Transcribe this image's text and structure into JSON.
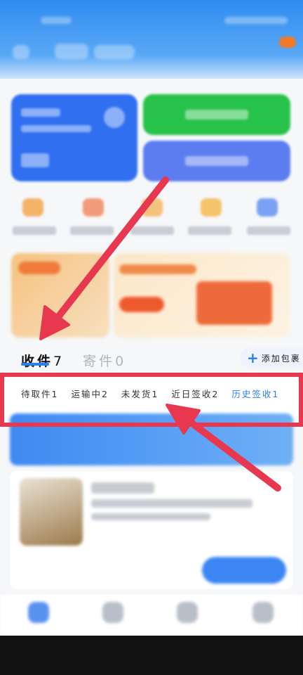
{
  "tabs": {
    "receive": {
      "label": "收件",
      "count": "7"
    },
    "send": {
      "label": "寄件",
      "count": "0"
    }
  },
  "add_parcel_button": {
    "icon": "plus-icon",
    "label": "添加包裹"
  },
  "status_filters": [
    {
      "label": "待取件1"
    },
    {
      "label": "运输中2"
    },
    {
      "label": "未发货1"
    },
    {
      "label": "近日签收2"
    },
    {
      "label": "历史签收1",
      "selected": true
    }
  ],
  "colors": {
    "accent": "#2a7ef0",
    "annotation": "#e8384f",
    "header_blue": "#2f8cf0",
    "green_tile": "#27c24a"
  }
}
